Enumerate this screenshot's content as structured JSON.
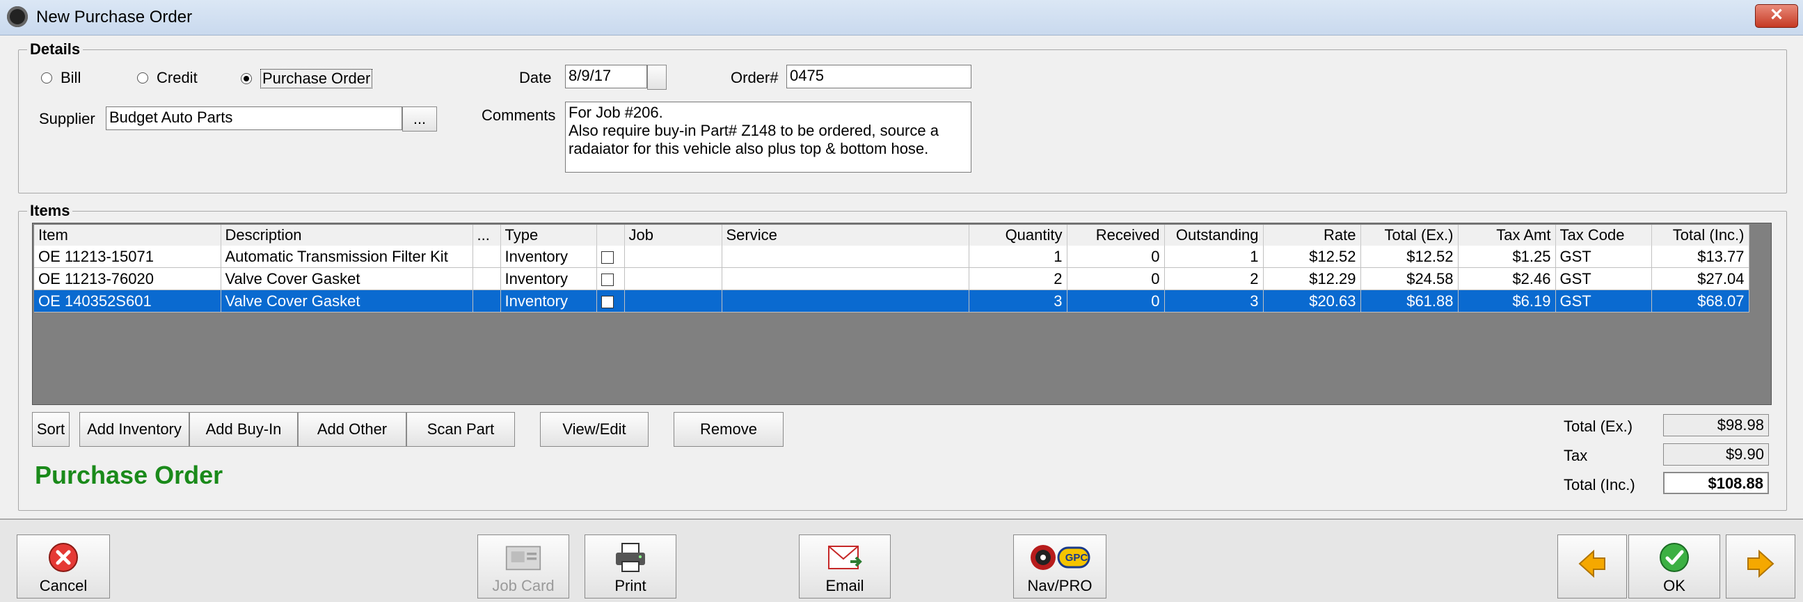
{
  "window": {
    "title": "New Purchase Order",
    "close_label": "✕"
  },
  "details": {
    "legend": "Details",
    "types": [
      {
        "label": "Bill",
        "selected": false
      },
      {
        "label": "Credit",
        "selected": false
      },
      {
        "label": "Purchase Order",
        "selected": true
      }
    ],
    "date_label": "Date",
    "date_value": "8/9/17",
    "order_label": "Order#",
    "order_value": "0475",
    "supplier_label": "Supplier",
    "supplier_value": "Budget Auto Parts",
    "supplier_browse_label": "...",
    "comments_label": "Comments",
    "comments_value": "For Job #206.\nAlso require buy-in Part# Z148 to be ordered, source a radaiator for this vehicle also plus top & bottom hose."
  },
  "items": {
    "legend": "Items",
    "columns": [
      "Item",
      "Description",
      "...",
      "Type",
      "",
      "Job",
      "Service",
      "Quantity",
      "Received",
      "Outstanding",
      "Rate",
      "Total (Ex.)",
      "Tax Amt",
      "Tax Code",
      "Total (Inc.)"
    ],
    "rows": [
      {
        "item": "OE 11213-15071",
        "description": "Automatic Transmission Filter  Kit",
        "type": "Inventory",
        "job": "",
        "service": "",
        "quantity": "1",
        "received": "0",
        "outstanding": "1",
        "rate": "$12.52",
        "total_ex": "$12.52",
        "tax_amt": "$1.25",
        "tax_code": "GST",
        "total_inc": "$13.77",
        "selected": false
      },
      {
        "item": "OE 11213-76020",
        "description": "Valve Cover Gasket",
        "type": "Inventory",
        "job": "",
        "service": "",
        "quantity": "2",
        "received": "0",
        "outstanding": "2",
        "rate": "$12.29",
        "total_ex": "$24.58",
        "tax_amt": "$2.46",
        "tax_code": "GST",
        "total_inc": "$27.04",
        "selected": false
      },
      {
        "item": "OE 140352S601",
        "description": "Valve Cover Gasket",
        "type": "Inventory",
        "job": "",
        "service": "",
        "quantity": "3",
        "received": "0",
        "outstanding": "3",
        "rate": "$20.63",
        "total_ex": "$61.88",
        "tax_amt": "$6.19",
        "tax_code": "GST",
        "total_inc": "$68.07",
        "selected": true
      }
    ],
    "buttons": {
      "sort": "Sort",
      "add_inventory": "Add Inventory",
      "add_buyin": "Add Buy-In",
      "add_other": "Add Other",
      "scan_part": "Scan Part",
      "view_edit": "View/Edit",
      "remove": "Remove"
    },
    "doc_type_label": "Purchase Order"
  },
  "totals": {
    "total_ex_label": "Total (Ex.)",
    "total_ex_value": "$98.98",
    "tax_label": "Tax",
    "tax_value": "$9.90",
    "total_inc_label": "Total (Inc.)",
    "total_inc_value": "$108.88"
  },
  "toolbar": {
    "cancel": "Cancel",
    "job_card": "Job Card",
    "print": "Print",
    "email": "Email",
    "nav_pro": "Nav/PRO",
    "gpc_badge": "GPC",
    "ok": "OK"
  },
  "icons": [
    "app-icon",
    "close-icon",
    "cancel-icon",
    "job-card-icon",
    "print-icon",
    "email-icon",
    "nav-pro-icon",
    "prev-arrow-icon",
    "ok-check-icon",
    "next-arrow-icon"
  ],
  "colors": {
    "status_green": "#1a8a1a",
    "selection_blue": "#0a6ad0",
    "cancel_red": "#e53935",
    "ok_green": "#3cb043",
    "arrow_orange": "#f5a800"
  }
}
